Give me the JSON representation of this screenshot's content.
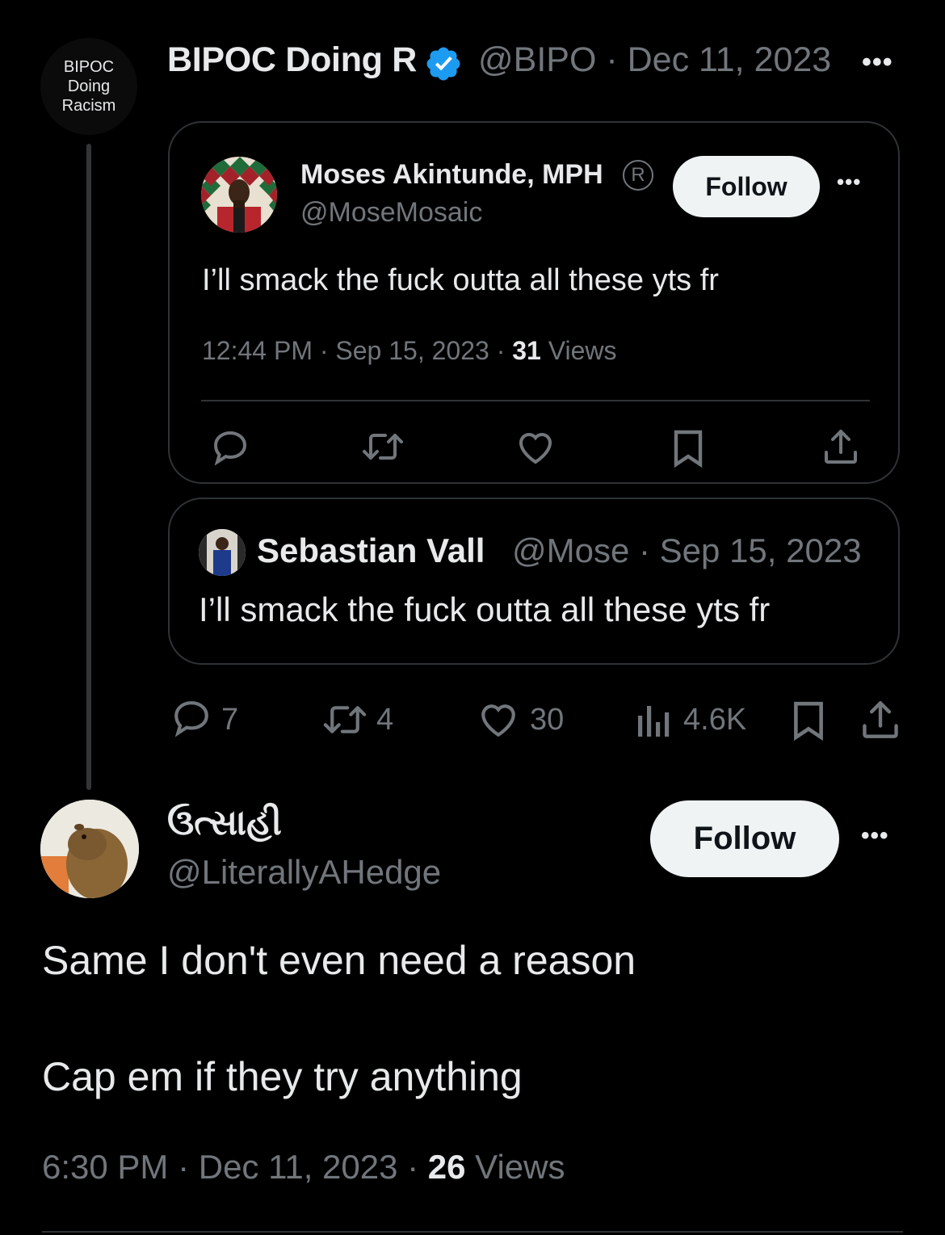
{
  "main_tweet": {
    "avatar_text": [
      "BIPOC",
      "Doing",
      "Racism"
    ],
    "name": "BIPOC Doing R",
    "handle_date": "@BIPO · Dec 11, 2023",
    "more": "•••",
    "stats": {
      "replies": "7",
      "retweets": "4",
      "likes": "30",
      "views": "4.6K"
    }
  },
  "quote_card_1": {
    "name": "Moses Akintunde, MPH",
    "badge": "R",
    "handle": "@MoseMosaic",
    "follow_label": "Follow",
    "more": "•••",
    "text": "I’ll smack the fuck outta all these yts fr",
    "meta_time": "12:44 PM · Sep 15, 2023 · ",
    "meta_views_count": "31",
    "meta_views_label": " Views"
  },
  "quote_card_2": {
    "name": "Sebastian Vall",
    "handle_date": "@Mose · Sep 15, 2023",
    "text": "I’ll smack the fuck outta all these yts fr"
  },
  "reply": {
    "name": "ઉત્સાહી",
    "handle": "@LiterallyAHedge",
    "follow_label": "Follow",
    "more": "•••",
    "line1": "Same I don't even need a reason",
    "line2": "Cap em if they try anything",
    "meta_time": "6:30 PM · Dec 11, 2023 · ",
    "meta_views_count": "26",
    "meta_views_label": " Views"
  },
  "colors": {
    "background": "#000000",
    "text": "#e7e9ea",
    "secondary": "#71767b",
    "border": "#2f3336",
    "verified": "#1d9bf0",
    "button_bg": "#eff3f4"
  }
}
